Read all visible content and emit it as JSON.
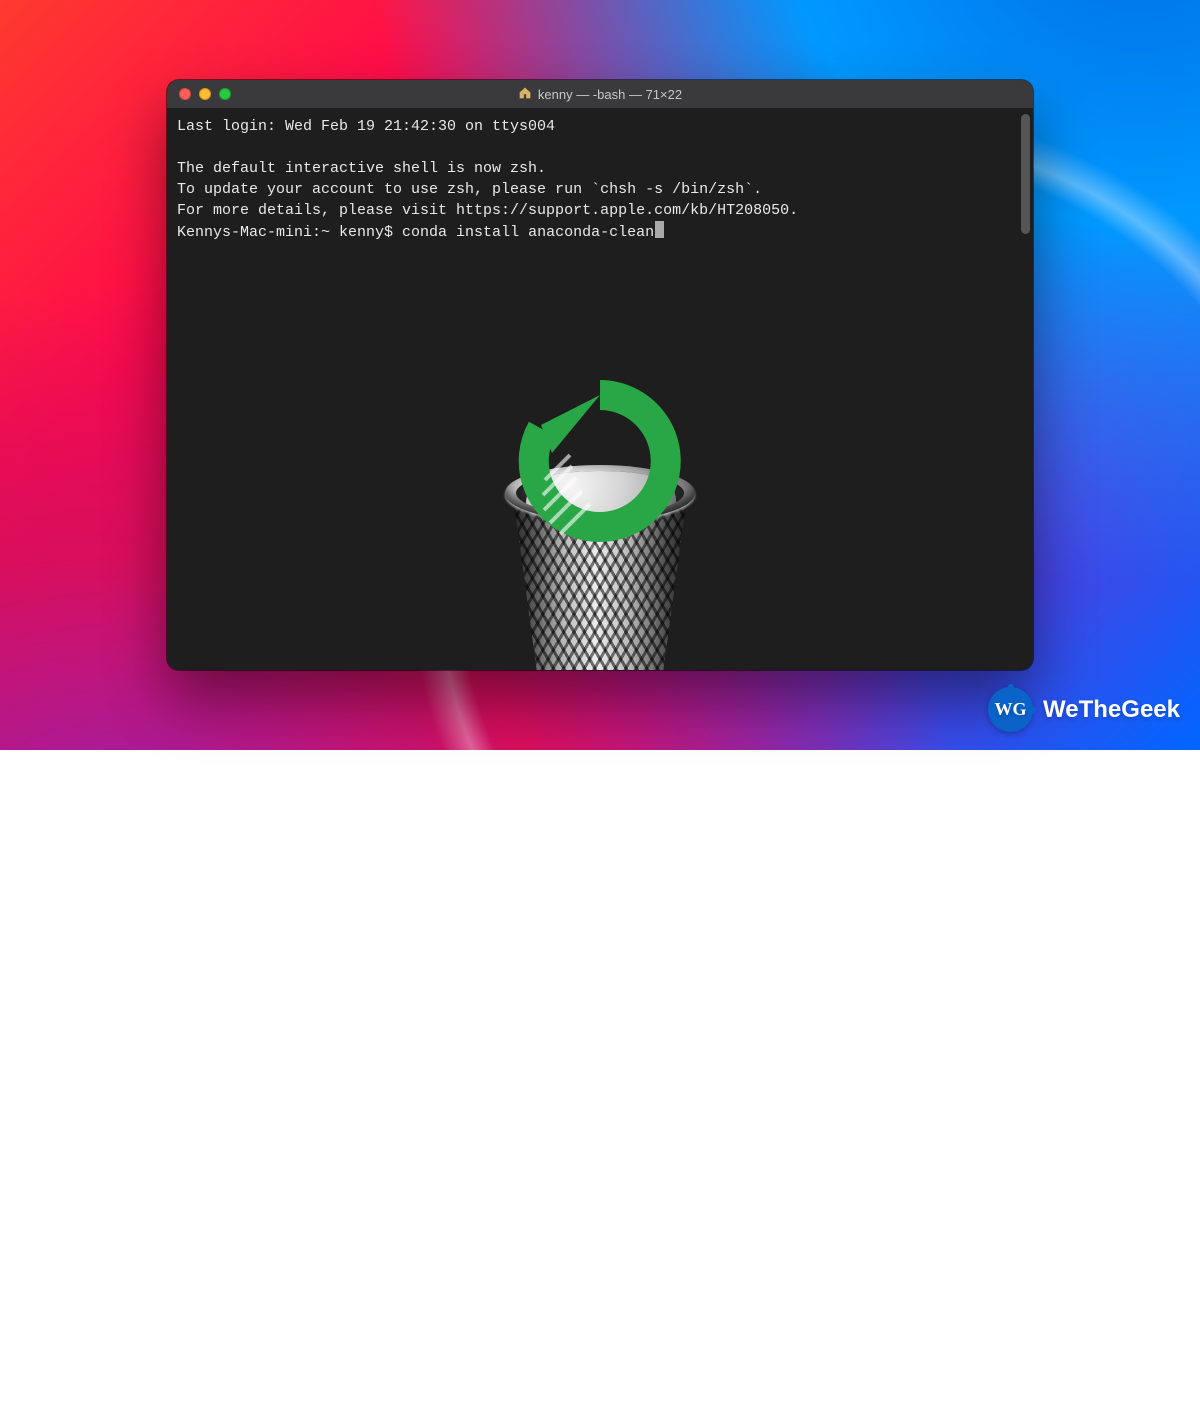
{
  "window": {
    "title": "kenny — -bash — 71×22"
  },
  "terminal": {
    "lines": [
      "Last login: Wed Feb 19 21:42:30 on ttys004",
      "",
      "The default interactive shell is now zsh.",
      "To update your account to use zsh, please run `chsh -s /bin/zsh`.",
      "For more details, please visit https://support.apple.com/kb/HT208050."
    ],
    "prompt": "Kennys-Mac-mini:~ kenny$ ",
    "command": "conda install anaconda-clean"
  },
  "watermark": {
    "badge": "WG",
    "text": "WeTheGeek"
  }
}
